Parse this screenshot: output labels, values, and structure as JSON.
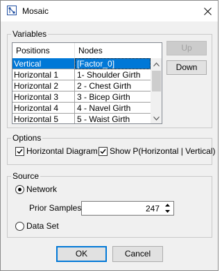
{
  "window": {
    "title": "Mosaic"
  },
  "variables": {
    "legend": "Variables",
    "columns": [
      "Positions",
      "Nodes"
    ],
    "rows": [
      {
        "position": "Vertical",
        "node": "[Factor_0]",
        "selected": true
      },
      {
        "position": "Horizontal 1",
        "node": "1- Shoulder Girth",
        "selected": false
      },
      {
        "position": "Horizontal 2",
        "node": "2 - Chest Girth",
        "selected": false
      },
      {
        "position": "Horizontal 3",
        "node": "3 - Bicep Girth",
        "selected": false
      },
      {
        "position": "Horizontal 4",
        "node": "4 - Navel Girth",
        "selected": false
      },
      {
        "position": "Horizontal 5",
        "node": "5 - Waist Girth",
        "selected": false
      }
    ],
    "up_label": "Up",
    "down_label": "Down"
  },
  "options": {
    "legend": "Options",
    "horizontal_diagram": {
      "label": "Horizontal Diagram",
      "checked": true
    },
    "show_p": {
      "label": "Show P(Horizontal | Vertical)",
      "checked": true
    }
  },
  "source": {
    "legend": "Source",
    "network": {
      "label": "Network",
      "selected": true
    },
    "prior_samples": {
      "label": "Prior Samples:",
      "value": "247"
    },
    "data_set": {
      "label": "Data Set",
      "selected": false
    }
  },
  "footer": {
    "ok_label": "OK",
    "cancel_label": "Cancel"
  },
  "colors": {
    "selection": "#0078d7",
    "dialog_bg": "#f0f0f0"
  }
}
